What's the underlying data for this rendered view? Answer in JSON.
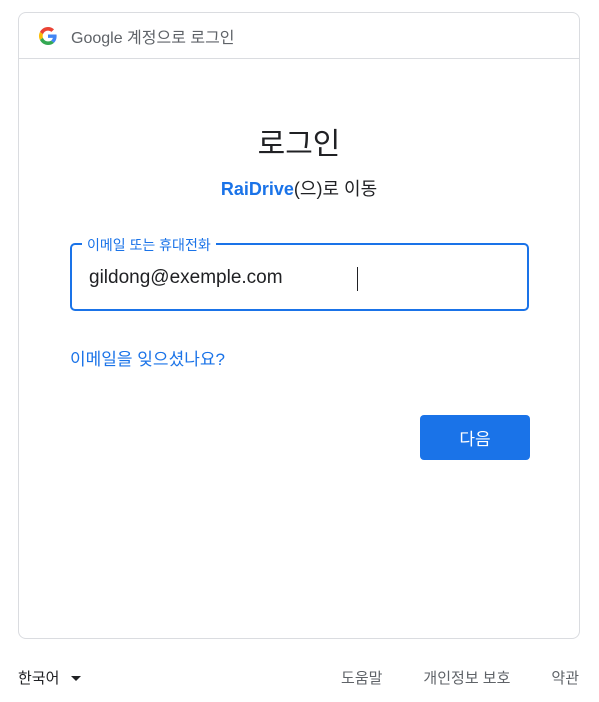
{
  "header": {
    "logo_icon": "google-g-icon",
    "title": "Google 계정으로 로그인"
  },
  "main": {
    "title": "로그인",
    "app_name": "RaiDrive",
    "subtitle_suffix": "(으)로 이동",
    "email_field": {
      "label": "이메일 또는 휴대전화",
      "value": "gildong@exemple.com"
    },
    "forgot_link": "이메일을 잊으셨나요?",
    "next_button": "다음"
  },
  "footer": {
    "language": "한국어",
    "links": [
      "도움말",
      "개인정보 보호",
      "약관"
    ]
  },
  "colors": {
    "accent": "#1a73e8",
    "border": "#dadce0",
    "text": "#202124",
    "muted": "#5f6368"
  }
}
